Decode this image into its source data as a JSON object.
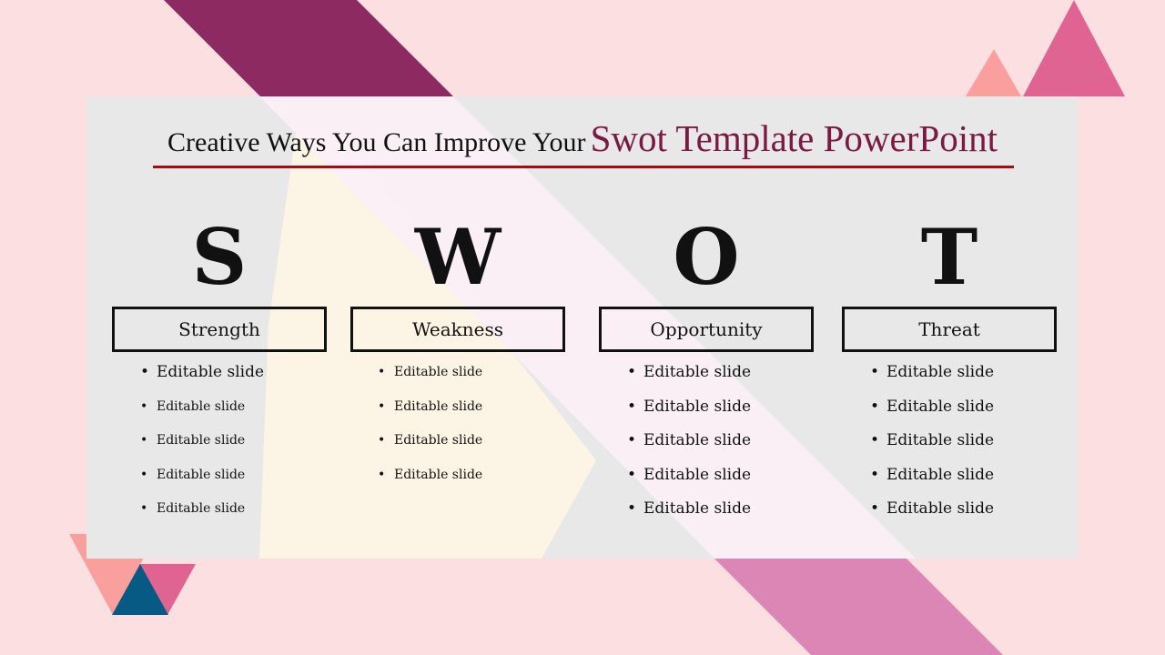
{
  "slide": {
    "title_prefix": "Creative Ways You Can Improve Your",
    "title_accent": "Swot Template PowerPoint",
    "colors": {
      "background": "#fcdfe1",
      "panel": "#e8e8e9",
      "title_accent": "#7a1a43",
      "title_rule": "#a50d14",
      "band_dark": "#8e2a62",
      "band_light": "#db86b4",
      "triangle_pink": "#e06492",
      "triangle_salmon": "#f9a09e",
      "triangle_navy": "#075a84"
    },
    "columns": [
      {
        "letter": "S",
        "label": "Strength",
        "items": [
          "Editable slide",
          "Editable slide",
          "Editable slide",
          "Editable slide",
          "Editable slide"
        ]
      },
      {
        "letter": "W",
        "label": "Weakness",
        "items": [
          "Editable slide",
          "Editable slide",
          "Editable slide",
          "Editable slide"
        ]
      },
      {
        "letter": "O",
        "label": "Opportunity",
        "items": [
          "Editable slide",
          "Editable slide",
          "Editable slide",
          "Editable slide",
          "Editable slide"
        ]
      },
      {
        "letter": "T",
        "label": "Threat",
        "items": [
          "Editable slide",
          "Editable slide",
          "Editable slide",
          "Editable slide",
          "Editable slide"
        ]
      }
    ]
  }
}
